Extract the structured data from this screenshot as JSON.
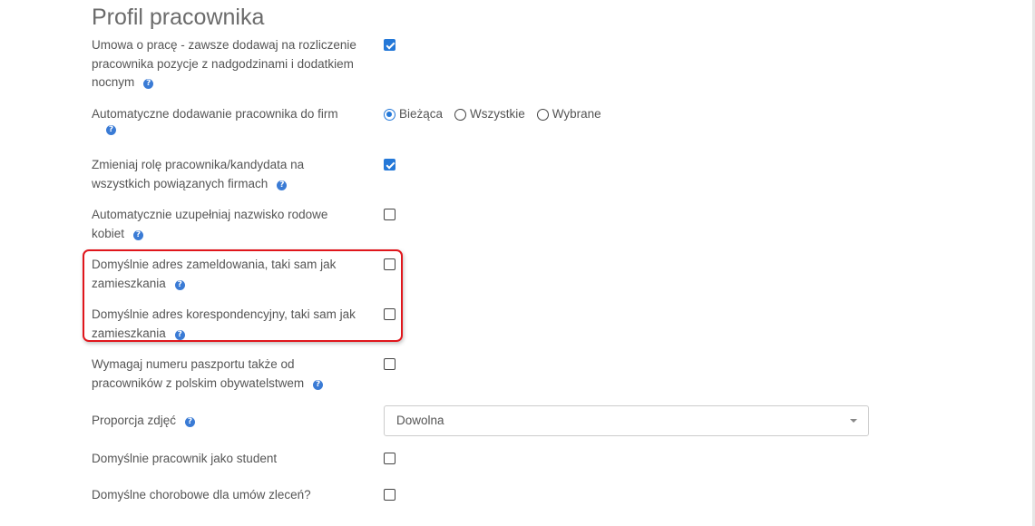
{
  "page": {
    "title": "Profil pracownika"
  },
  "settings": {
    "umowa": {
      "label": "Umowa o pracę - zawsze dodawaj na rozliczenie pracownika pozycje z nadgodzinami i dodatkiem nocnym",
      "checked": true
    },
    "auto_dodawanie": {
      "label": "Automatyczne dodawanie pracownika do firm",
      "options": [
        "Bieżąca",
        "Wszystkie",
        "Wybrane"
      ],
      "selected": "Bieżąca"
    },
    "zmieniaj_role": {
      "label": "Zmieniaj rolę pracownika/kandydata na wszystkich powiązanych firmach",
      "checked": true
    },
    "nazwisko_rodowe": {
      "label": "Automatycznie uzupełniaj nazwisko rodowe kobiet",
      "checked": false
    },
    "adres_zameldowania": {
      "label": "Domyślnie adres zameldowania, taki sam jak zamieszkania",
      "checked": false
    },
    "adres_korespondencyjny": {
      "label": "Domyślnie adres korespondencyjny, taki sam jak zamieszkania",
      "checked": false
    },
    "paszport": {
      "label": "Wymagaj numeru paszportu także od pracowników z polskim obywatelstwem",
      "checked": false
    },
    "proporcja": {
      "label": "Proporcja zdjęć",
      "value": "Dowolna"
    },
    "student": {
      "label": "Domyślnie pracownik jako student",
      "checked": false
    },
    "chorobowe": {
      "label": "Domyślne chorobowe dla umów zleceń?",
      "checked": false
    }
  },
  "icons": {
    "help_glyph": "?",
    "help_color": "#3a7bd5",
    "accent": "#2478d8",
    "highlight": "#e0161c"
  }
}
